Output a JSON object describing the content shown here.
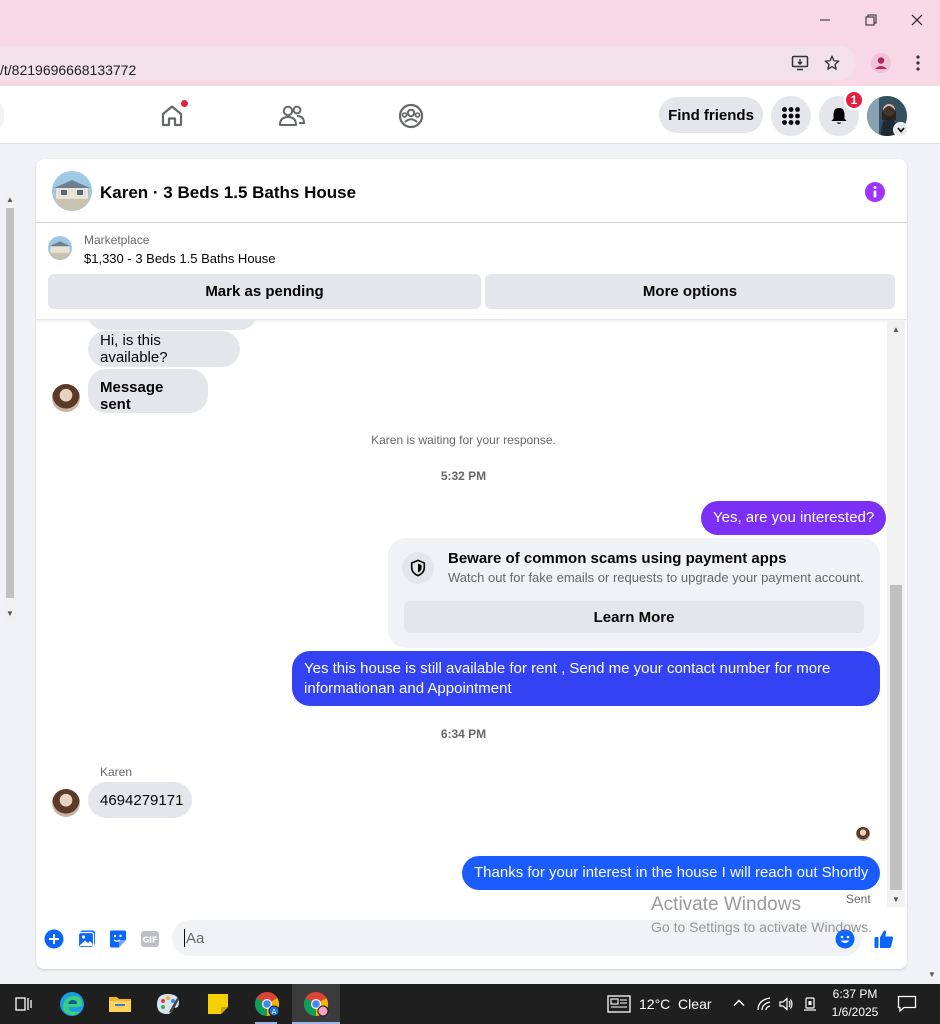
{
  "browser": {
    "url": "/t/8219696668133772",
    "window_controls": [
      "minimize",
      "restore",
      "close"
    ]
  },
  "fbnav": {
    "find_friends_label": "Find friends",
    "notification_count": "1"
  },
  "chat": {
    "header_title": "Karen · 3 Beds 1.5 Baths House",
    "marketplace": {
      "label": "Marketplace",
      "listing": "$1,330 - 3 Beds 1.5 Baths House",
      "mark_pending_label": "Mark as pending",
      "more_options_label": "More options"
    },
    "messages": {
      "msg1": "Hi, is this available?",
      "msg2": "Message sent",
      "waiting": "Karen is waiting for your response.",
      "time1": "5:32 PM",
      "out1": "Yes, are you interested?",
      "scam_title": "Beware of common scams using payment apps",
      "scam_sub": "Watch out for fake emails or requests to upgrade your payment account.",
      "learn_more": "Learn More",
      "out2": "Yes this house is still available for rent , Send me your contact number for more informationan and Appointment",
      "time2": "6:34 PM",
      "sender_name": "Karen",
      "in3": "4694279171",
      "out3": "Thanks for your interest in the house I will reach out Shortly",
      "sent_status": "Sent"
    },
    "composer": {
      "placeholder": "Aa"
    }
  },
  "watermark": {
    "line1": "Activate Windows",
    "line2": "Go to Settings to activate Windows."
  },
  "taskbar": {
    "weather": "12°C  Clear",
    "time": "6:37 PM",
    "date": "1/6/2025"
  },
  "colors": {
    "messenger_purple": "#7b2ff7",
    "messenger_blue": "#1a5cff",
    "fb_gray": "#e4e6eb",
    "notification_red": "#e41e3f"
  }
}
